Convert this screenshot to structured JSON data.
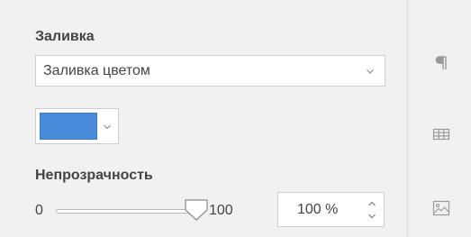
{
  "fill": {
    "section_title": "Заливка",
    "fill_type_selected": "Заливка цветом",
    "color_hex": "#4a8ada"
  },
  "opacity": {
    "title": "Непрозрачность",
    "slider_min": "0",
    "slider_max": "100",
    "slider_value_fraction": 1.0,
    "field_value": "100 %"
  },
  "right_toolbar": {
    "icons": [
      "paragraph-icon",
      "table-icon",
      "image-icon"
    ]
  }
}
